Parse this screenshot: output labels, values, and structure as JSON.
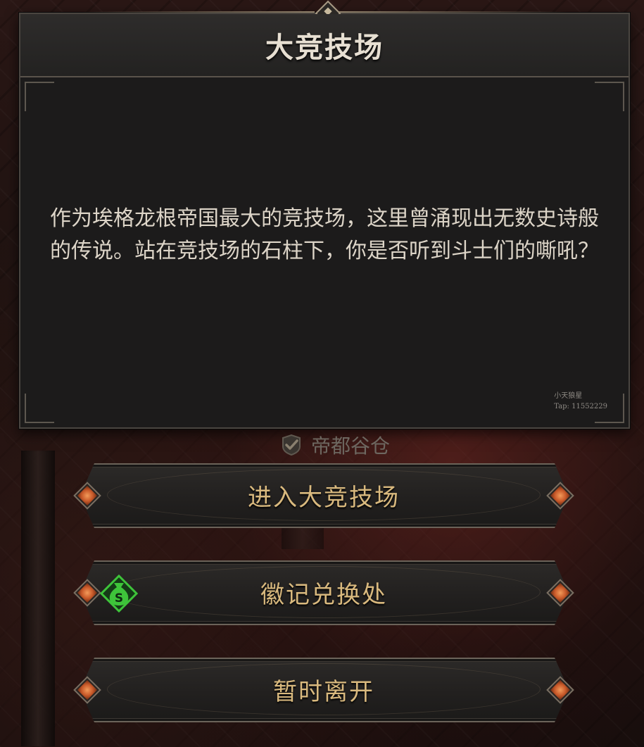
{
  "dialog": {
    "title": "大竞技场",
    "body": "作为埃格龙根帝国最大的竞技场，这里曾涌现出无数史诗般的传说。站在竞技场的石柱下，你是否听到斗士们的嘶吼？",
    "watermark_line1": "小天狼星",
    "watermark_line2": "Tap: 11552229"
  },
  "location": {
    "label": "帝都谷仓",
    "icon": "checkmark-shield-icon"
  },
  "options": [
    {
      "label": "进入大竞技场"
    },
    {
      "label": "徽记兑换处",
      "icon": "money-bag-icon",
      "icon_color": "#3ec43a"
    },
    {
      "label": "暂时离开"
    }
  ],
  "colors": {
    "title": "#e7dfd2",
    "body_text": "#ddd5c8",
    "button_text": "#d9b97e",
    "gem": "#e0763a",
    "panel_bg": "#1c1b1b"
  }
}
